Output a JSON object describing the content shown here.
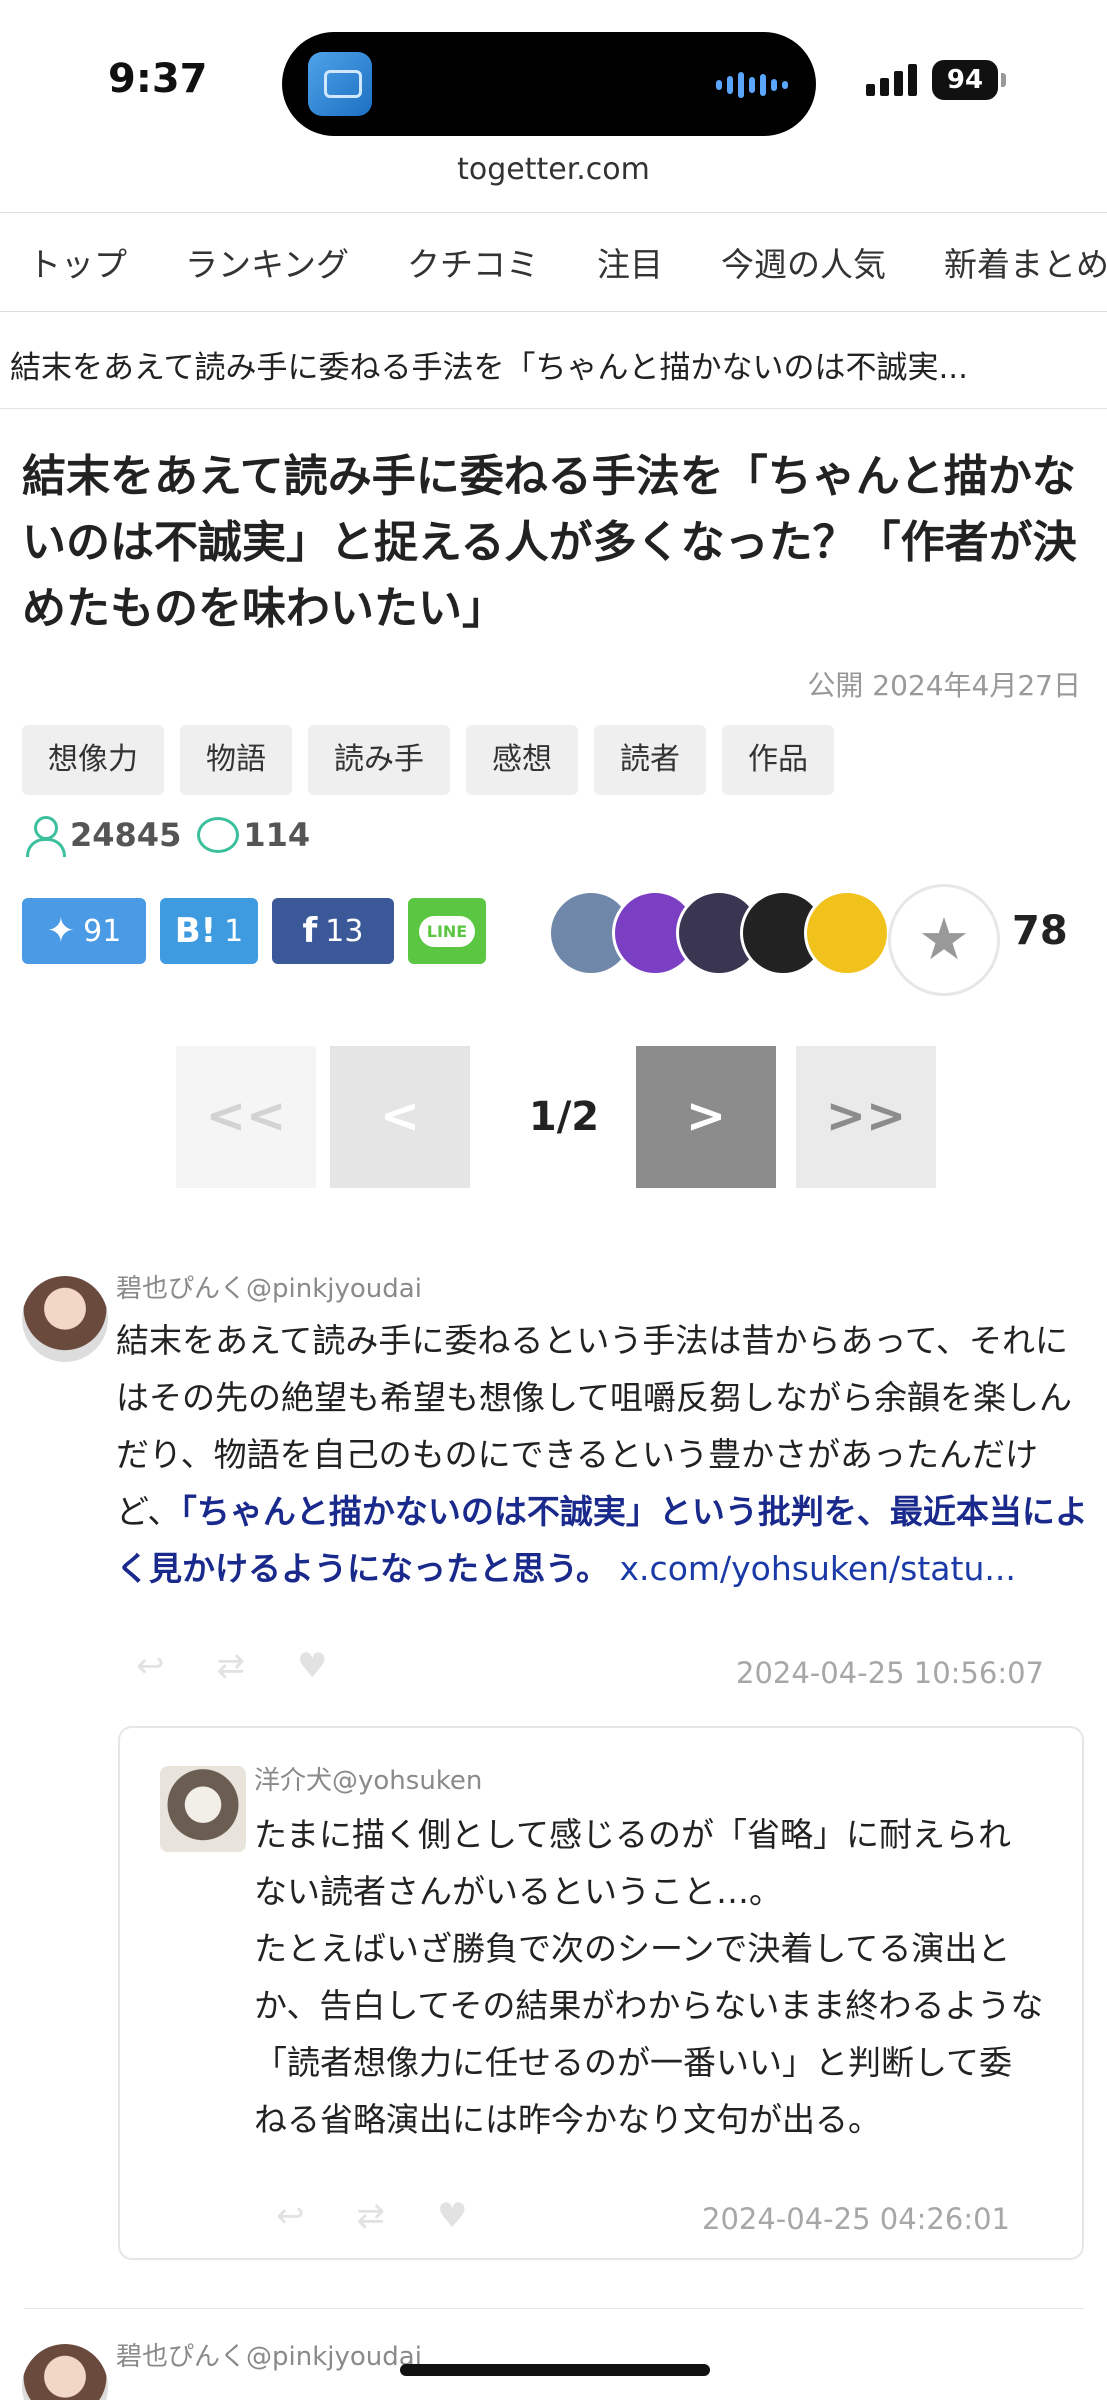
{
  "status_bar": {
    "time": "9:37",
    "battery": "94",
    "url": "togetter.com"
  },
  "nav": {
    "items": [
      "トップ",
      "ランキング",
      "クチコミ",
      "注目",
      "今週の人気",
      "新着まとめ"
    ]
  },
  "breadcrumb": "結末をあえて読み手に委ねる手法を「ちゃんと描かないのは不誠実...",
  "article": {
    "title": "結末をあえて読み手に委ねる手法を「ちゃんと描かないのは不誠実」と捉える人が多くなった？「作者が決めたものを味わいたい」",
    "published": "公開 2024年4月27日",
    "tags": [
      "想像力",
      "物語",
      "読み手",
      "感想",
      "読者",
      "作品"
    ],
    "views": "24845",
    "comments": "114"
  },
  "share": {
    "twitter_count": "91",
    "hatena_label": "B!",
    "hatena_count": "1",
    "facebook_count": "13",
    "line_label": "LINE"
  },
  "favorites": {
    "count": "78",
    "avatar_colors": [
      "#6f87a8",
      "#7b3fc4",
      "#3a3550",
      "#222222",
      "#f1c21b"
    ]
  },
  "pager": {
    "first": "<<",
    "prev": "<",
    "label": "1/2",
    "next": ">",
    "last": ">>"
  },
  "tweets": [
    {
      "name": "碧也ぴんく@pinkjyoudai",
      "text_plain": "結末をあえて読み手に委ねるという手法は昔からあって、それにはその先の絶望も希望も想像して咀嚼反芻しながら余韻を楽しんだり、物語を自己のものにできるという豊かさがあったんだけど、",
      "text_highlight": "「ちゃんと描かないのは不誠実」という批判を、最近本当によく見かけるようになったと思う。",
      "link": "x.com/yohsuken/statu...",
      "time": "2024-04-25 10:56:07"
    },
    {
      "name": "洋介犬@yohsuken",
      "text": "たまに描く側として感じるのが「省略」に耐えられない読者さんがいるということ…。\nたとえばいざ勝負で次のシーンで決着してる演出とか、告白してその結果がわからないまま終わるような「読者想像力に任せるのが一番いい」と判断して委ねる省略演出には昨今かなり文句が出る。",
      "time": "2024-04-25 04:26:01"
    },
    {
      "name": "碧也ぴんく@pinkjyoudai"
    }
  ]
}
